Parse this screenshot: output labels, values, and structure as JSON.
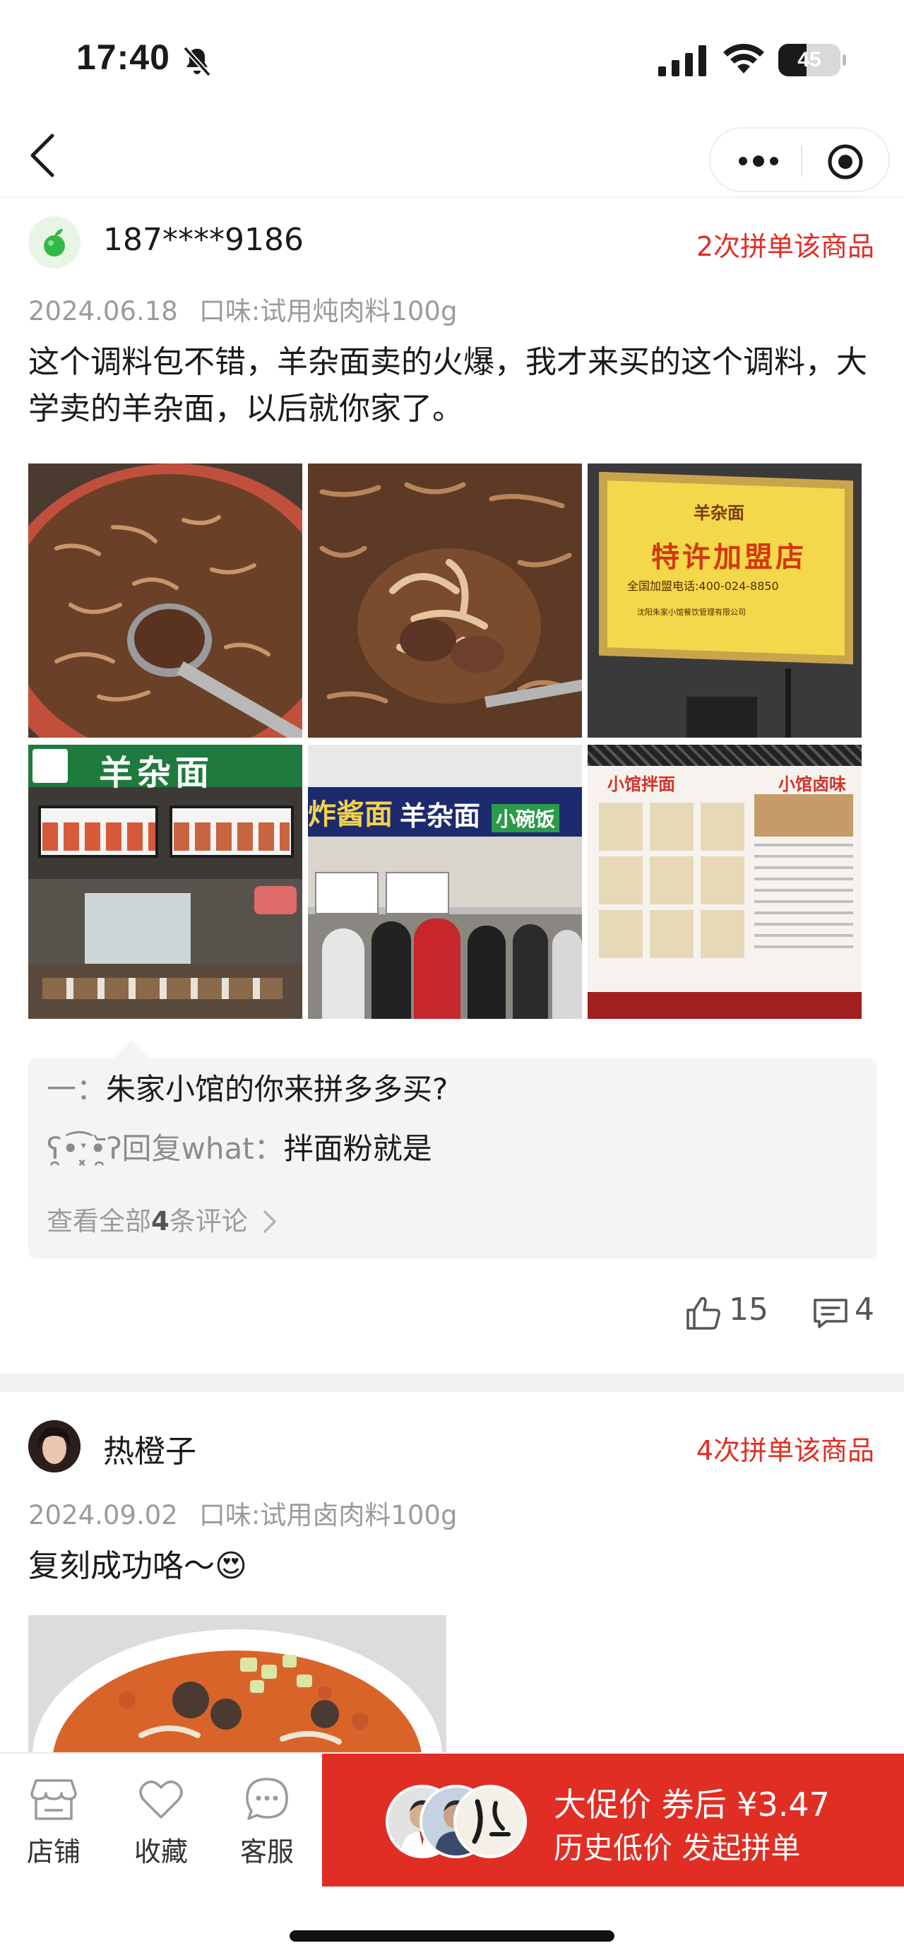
{
  "status_bar": {
    "time": "17:40",
    "battery": "45",
    "battery_level": 0.45
  },
  "review1": {
    "username": "187****9186",
    "buy_count": "2次拼单该商品",
    "date": "2024.06.18",
    "flavor": "口味:试用炖肉料100g",
    "text": "这个调料包不错，羊杂面卖的火爆，我才来买的这个调料，大学卖的羊杂面，以后就你家了。",
    "certificate": {
      "brand": "羊杂面",
      "title": "特许加盟店",
      "phone": "全国加盟电话:400-024-8850",
      "company": "沈阳朱家小馆餐饮管理有限公司"
    },
    "shop_sign": "羊杂面",
    "stall_signs": [
      "炸酱面",
      "羊杂面",
      "小碗饭"
    ],
    "menu_board": {
      "left": "小馆拌面",
      "right": "小馆卤味"
    },
    "comments": [
      {
        "name": "一：",
        "text": "朱家小馆的你来拼多多买?"
      },
      {
        "name": "ʕ̯•͡ˑ͓•̯᷅ʔ回复what：",
        "text": "拌面粉就是"
      }
    ],
    "comments_more": {
      "prefix": "查看全部",
      "count": "4",
      "suffix": "条评论"
    },
    "likes": "15",
    "comment_count": "4"
  },
  "review2": {
    "username": "热橙子",
    "buy_count": "4次拼单该商品",
    "date": "2024.09.02",
    "flavor": "口味:试用卤肉料100g",
    "text": "复刻成功咯～😍"
  },
  "bottom_bar": {
    "shop": "店铺",
    "favorite": "收藏",
    "service": "客服",
    "cta_line1": "大促价  券后 ¥3.47",
    "cta_line2": "历史低价  发起拼单"
  },
  "colors": {
    "accent": "#e02e24",
    "muted": "#9b9b9b"
  },
  "icons": [
    "bell-slash-icon",
    "signal-icon",
    "wifi-icon",
    "battery-icon",
    "back-icon",
    "more-icon",
    "target-icon",
    "thumbs-up-icon",
    "comment-icon",
    "store-icon",
    "heart-icon",
    "chat-icon"
  ]
}
